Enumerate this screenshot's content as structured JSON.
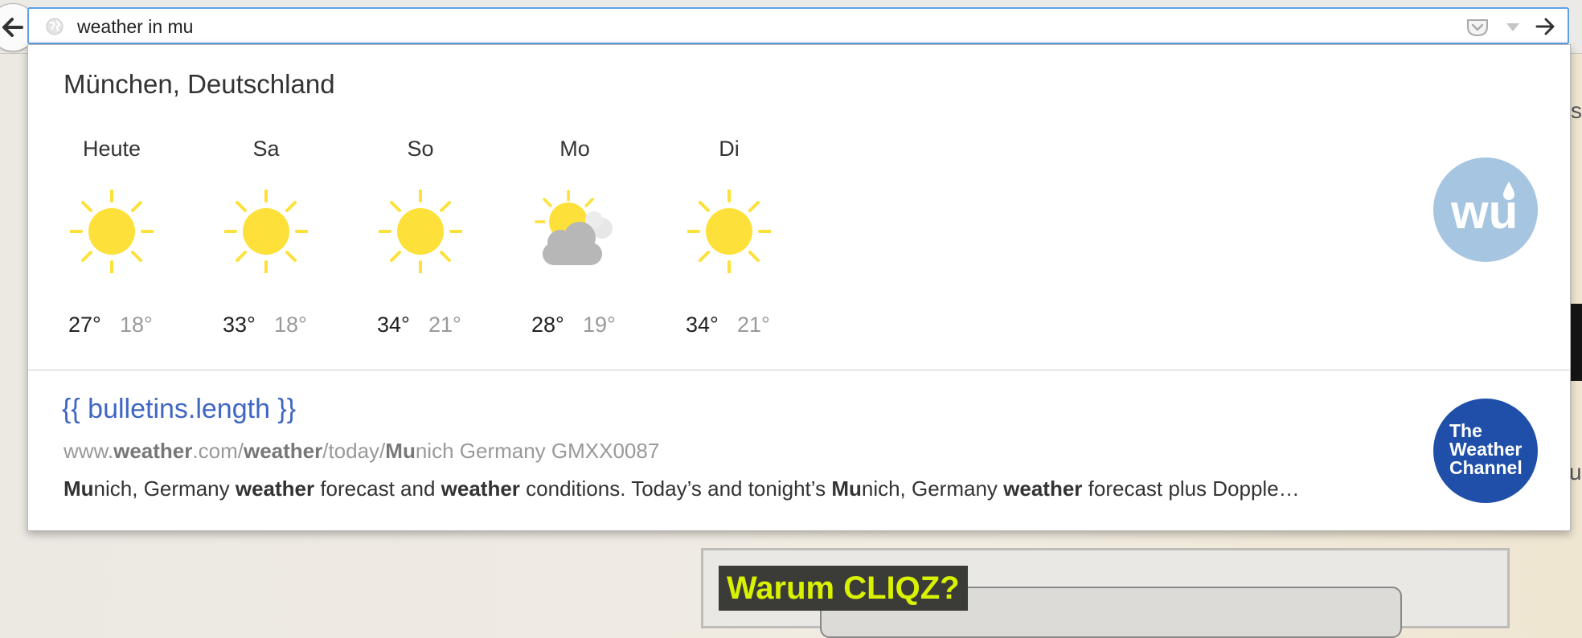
{
  "toolbar": {
    "url_value": "weather in mu"
  },
  "weather": {
    "city": "München, Deutschland",
    "days": [
      {
        "name": "Heute",
        "icon": "sun-icon",
        "max": "27°",
        "min": "18°"
      },
      {
        "name": "Sa",
        "icon": "sun-icon",
        "max": "33°",
        "min": "18°"
      },
      {
        "name": "So",
        "icon": "sun-icon",
        "max": "34°",
        "min": "21°"
      },
      {
        "name": "Mo",
        "icon": "partly-cloudy-icon",
        "max": "28°",
        "min": "19°"
      },
      {
        "name": "Di",
        "icon": "sun-icon",
        "max": "34°",
        "min": "21°"
      }
    ],
    "logo_text": "wu"
  },
  "result": {
    "title": "{{ bulletins.length }}",
    "url_parts": [
      {
        "text": "www.",
        "bold": false
      },
      {
        "text": "weather",
        "bold": true
      },
      {
        "text": ".com/",
        "bold": false
      },
      {
        "text": "weather",
        "bold": true
      },
      {
        "text": "/today/",
        "bold": false
      },
      {
        "text": "Mu",
        "bold": true
      },
      {
        "text": "nich Germany GMXX0087",
        "bold": false
      }
    ],
    "desc_parts": [
      {
        "text": "Mu",
        "bold": true
      },
      {
        "text": "nich, Germany ",
        "bold": false
      },
      {
        "text": "weather",
        "bold": true
      },
      {
        "text": " forecast and ",
        "bold": false
      },
      {
        "text": "weather",
        "bold": true
      },
      {
        "text": " conditions. Today’s and tonight’s ",
        "bold": false
      },
      {
        "text": "Mu",
        "bold": true
      },
      {
        "text": "nich, Germany ",
        "bold": false
      },
      {
        "text": "weather",
        "bold": true
      },
      {
        "text": " forecast plus Dopple…",
        "bold": false
      }
    ],
    "logo_lines": [
      "The",
      "Weather",
      "Channel"
    ]
  },
  "background": {
    "promo_label": "Warum CLIQZ?",
    "right_edge_top": "s",
    "right_edge_bottom": "u"
  },
  "colors": {
    "sun": "#fde13a",
    "cloud": "#b7b7b7",
    "link": "#3f66c2",
    "wu_logo": "#a6c5e1",
    "twc_logo": "#1f4fa8",
    "focus_ring": "#5ea0e9",
    "promo_text": "#d9f200"
  }
}
